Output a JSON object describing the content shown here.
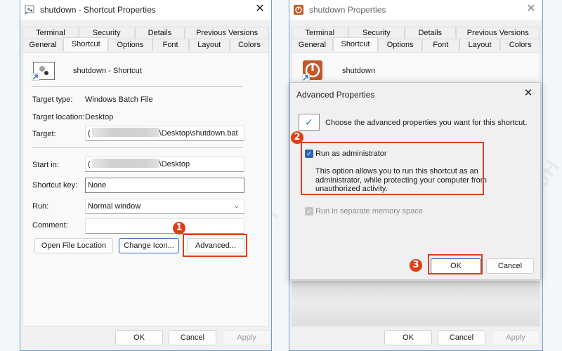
{
  "left_window": {
    "title": "shutdown - Shortcut Properties",
    "close_glyph": "✕",
    "tabs_row1": [
      "Terminal",
      "Security",
      "Details",
      "Previous Versions"
    ],
    "tabs_row2": [
      "General",
      "Shortcut",
      "Options",
      "Font",
      "Layout",
      "Colors"
    ],
    "active_tab": "Shortcut",
    "shortcut_name": "shutdown - Shortcut",
    "fields": {
      "target_type_label": "Target type:",
      "target_type_value": "Windows Batch File",
      "target_location_label": "Target location:",
      "target_location_value": "Desktop",
      "target_label": "Target:",
      "target_prefix": "(",
      "target_value": "\\Desktop\\shutdown.bat",
      "start_in_label": "Start in:",
      "start_in_prefix": "(",
      "start_in_value": "\\Desktop",
      "shortcut_key_label": "Shortcut key:",
      "shortcut_key_value": "None",
      "run_label": "Run:",
      "run_value": "Normal window",
      "comment_label": "Comment:",
      "comment_value": ""
    },
    "buttons": {
      "open_file_location": "Open File Location",
      "change_icon": "Change Icon...",
      "advanced": "Advanced..."
    },
    "footer": {
      "ok": "OK",
      "cancel": "Cancel",
      "apply": "Apply"
    }
  },
  "right_window": {
    "title": "shutdown Properties",
    "close_glyph": "✕",
    "tabs_row1": [
      "Terminal",
      "Security",
      "Details",
      "Previous Versions"
    ],
    "tabs_row2": [
      "General",
      "Shortcut",
      "Options",
      "Font",
      "Layout",
      "Colors"
    ],
    "active_tab": "Shortcut",
    "shortcut_name": "shutdown",
    "footer": {
      "ok": "OK",
      "cancel": "Cancel",
      "apply": "Apply"
    }
  },
  "advanced_dialog": {
    "title": "Advanced Properties",
    "close_glyph": "✕",
    "intro": "Choose the advanced properties you want for this shortcut.",
    "run_as_admin": {
      "label": "Run as administrator",
      "checked": true
    },
    "run_as_admin_desc": "This option allows you to run this shortcut as an administrator, while protecting your computer from unauthorized activity.",
    "separate_memory": {
      "label": "Run in separate memory space",
      "checked": true,
      "disabled": true
    },
    "ok": "OK",
    "cancel": "Cancel"
  },
  "annotations": {
    "step1": "1",
    "step2": "2",
    "step3": "3"
  },
  "colors": {
    "annotation": "#e03d17",
    "accent": "#2e66b5",
    "window_border": "#6e9bd0"
  }
}
